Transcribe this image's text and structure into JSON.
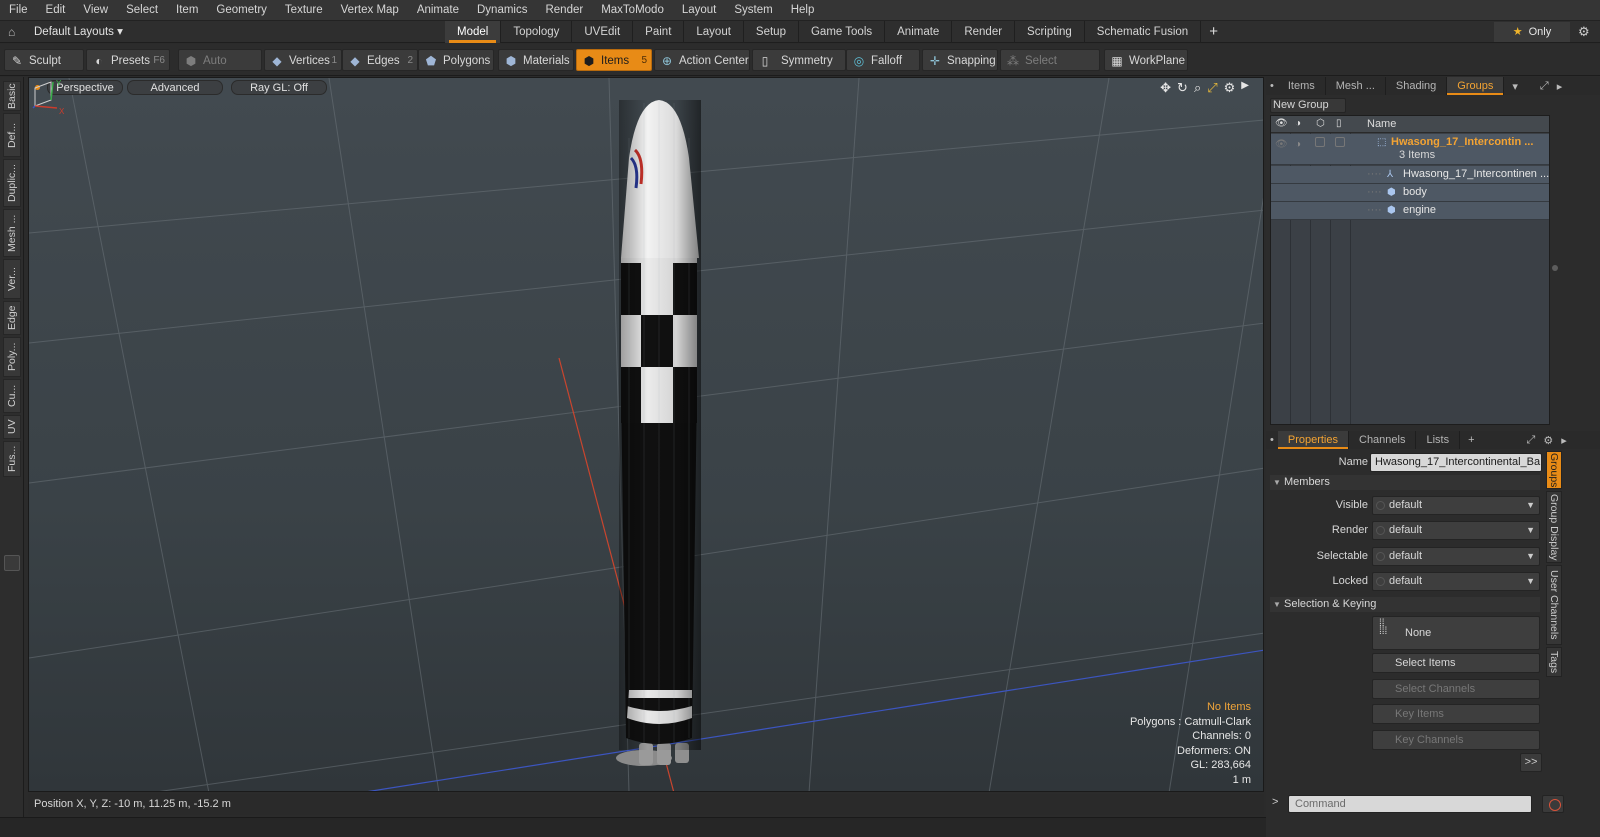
{
  "menu": [
    "File",
    "Edit",
    "View",
    "Select",
    "Item",
    "Geometry",
    "Texture",
    "Vertex Map",
    "Animate",
    "Dynamics",
    "Render",
    "MaxToModo",
    "Layout",
    "System",
    "Help"
  ],
  "layout": {
    "selector": "Default Layouts ▾",
    "tabs": [
      "Model",
      "Topology",
      "UVEdit",
      "Paint",
      "Layout",
      "Setup",
      "Game Tools",
      "Animate",
      "Render",
      "Scripting",
      "Schematic Fusion"
    ],
    "active_tab": "Model",
    "plus": "+",
    "only_label": "Only"
  },
  "toolbar": {
    "sculpt": "Sculpt",
    "presets": "Presets",
    "presets_key": "F6",
    "auto_select": "Auto Select",
    "vertices": "Vertices",
    "vertices_key": "1",
    "edges": "Edges",
    "edges_key": "2",
    "polygons": "Polygons",
    "materials": "Materials",
    "items": "Items",
    "items_key": "5",
    "action_center": "Action Center",
    "symmetry": "Symmetry",
    "falloff": "Falloff",
    "snapping": "Snapping",
    "select_through": "Select Through",
    "workplane": "WorkPlane"
  },
  "left_tabs": [
    "Basic",
    "Def...",
    "Duplic...",
    "Mesh ...",
    "Ver...",
    "Edge",
    "Poly...",
    "Cu...",
    "UV",
    "Fus..."
  ],
  "viewport": {
    "perspective": "Perspective",
    "advanced": "Advanced",
    "raygl": "Ray GL: Off",
    "info": {
      "no_items": "No Items",
      "polygons": "Polygons : Catmull-Clark",
      "channels": "Channels: 0",
      "deformers": "Deformers: ON",
      "gl": "GL: 283,664",
      "scale": "1 m"
    }
  },
  "status": {
    "position": "Position X, Y, Z:  -10 m, 11.25 m, -15.2 m"
  },
  "right_panel": {
    "top_tabs": [
      "Items",
      "Mesh ...",
      "Shading",
      "Groups"
    ],
    "top_active": "Groups",
    "new_group": "New Group",
    "list_header": "Name",
    "group_name": "Hwasong_17_Intercontin ...",
    "group_count": "3 Items",
    "children": [
      {
        "name": "Hwasong_17_Intercontinen ...",
        "icon": "locator-icon"
      },
      {
        "name": "body",
        "icon": "mesh-icon"
      },
      {
        "name": "engine",
        "icon": "mesh-icon"
      }
    ],
    "prop_tabs": [
      "Properties",
      "Channels",
      "Lists"
    ],
    "prop_active": "Properties",
    "name_label": "Name",
    "name_value": "Hwasong_17_Intercontinental_Ba",
    "members_label": "Members",
    "visible_label": "Visible",
    "render_label": "Render",
    "selectable_label": "Selectable",
    "locked_label": "Locked",
    "default_value": "default",
    "selection_keying": "Selection & Keying",
    "none_label": "None",
    "select_items": "Select Items",
    "select_channels": "Select Channels",
    "key_items": "Key Items",
    "key_channels": "Key Channels",
    "more": ">>",
    "side_tabs": [
      "Groups",
      "Group Display",
      "User Channels",
      "Tags"
    ],
    "command_placeholder": "Command",
    "command_prompt": ">"
  },
  "colors": {
    "accent": "#e88b16",
    "highlight_text": "#f3a333",
    "selection_row": "#4e5864"
  }
}
